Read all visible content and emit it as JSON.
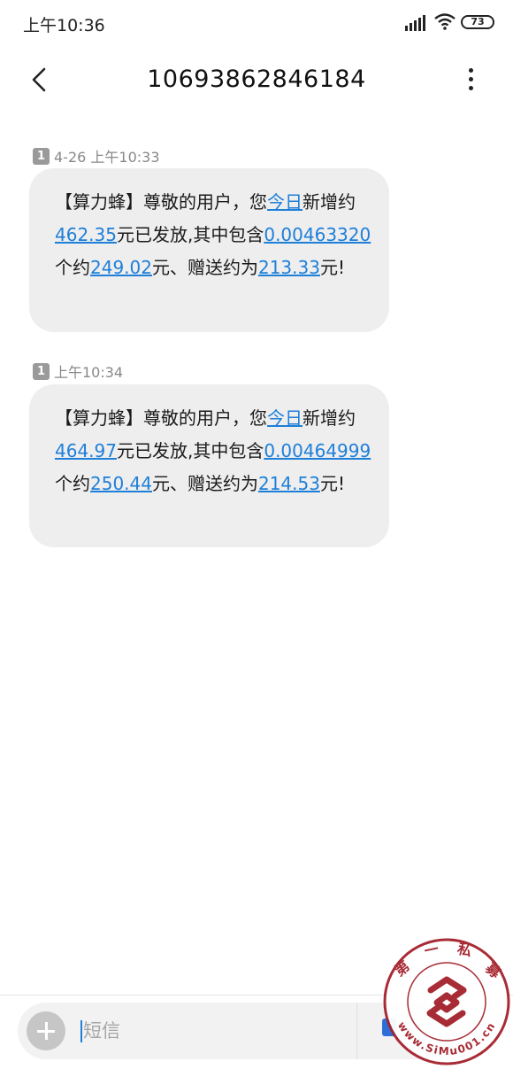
{
  "status_bar": {
    "time": "上午10:36",
    "battery_level": "73"
  },
  "header": {
    "title": "10693862846184"
  },
  "messages": [
    {
      "sim": "1",
      "timestamp": "4-26 上午10:33",
      "segments": [
        "【算力蜂】尊敬的用户，您",
        "今日",
        "新增约",
        "462.35",
        "元已发放,其中包含",
        "0.00463320",
        "个约",
        "249.02",
        "元、赠送约为",
        "213.33",
        "元!"
      ]
    },
    {
      "sim": "1",
      "timestamp": "上午10:34",
      "segments": [
        "【算力蜂】尊敬的用户，您",
        "今日",
        "新增约",
        "464.97",
        "元已发放,其中包含",
        "0.00464999",
        "个约",
        "250.44",
        "元、赠送约为",
        "214.53",
        "元!"
      ]
    }
  ],
  "composer": {
    "placeholder": "短信"
  },
  "watermark": {
    "chars": [
      "第",
      "一",
      "私",
      "募"
    ],
    "url": "www.SiMu001.cn"
  },
  "colors": {
    "link": "#1e7fd9",
    "bubble": "#eeeeee",
    "watermark": "#a4212b"
  }
}
